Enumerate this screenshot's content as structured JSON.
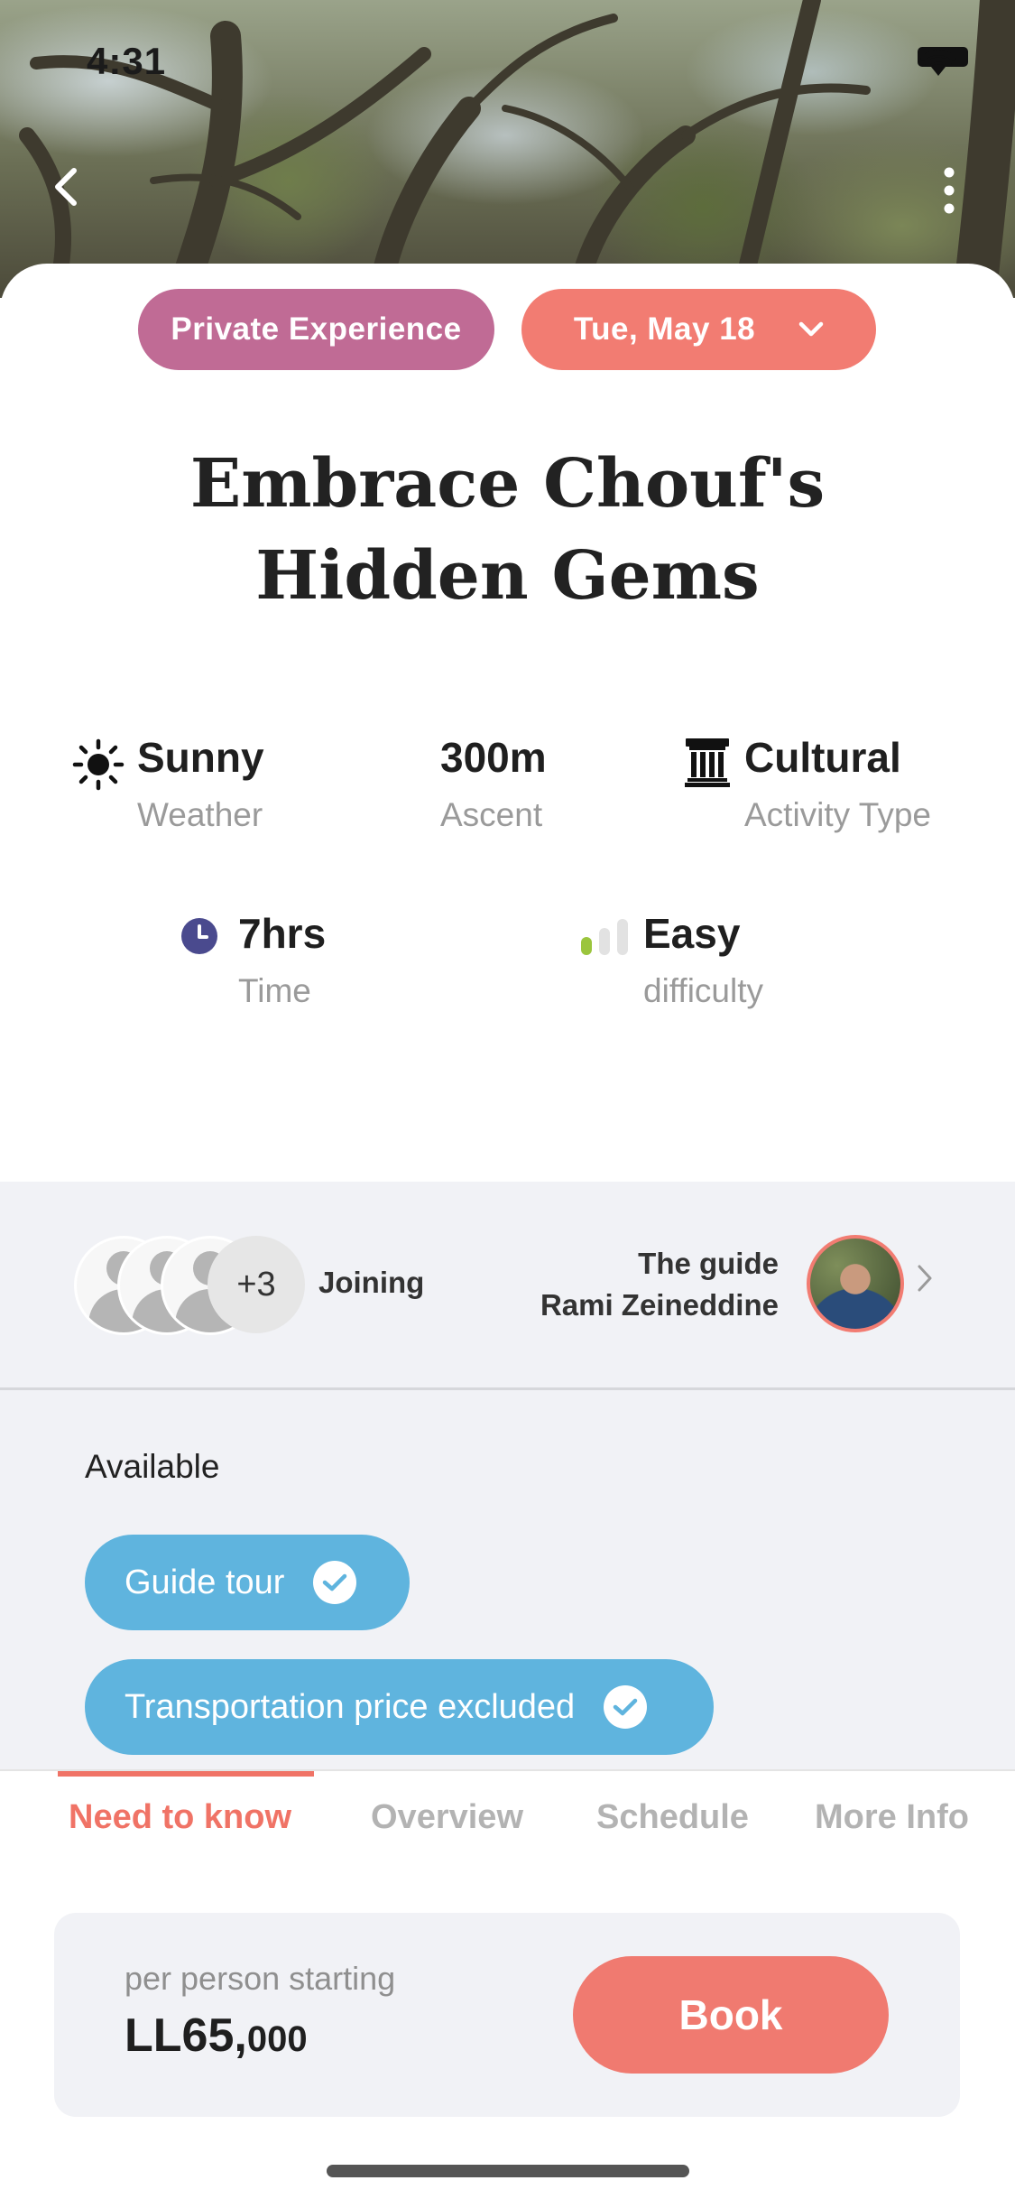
{
  "status_bar": {
    "time": "4:31"
  },
  "hero": {
    "back_icon": "chevron-left-icon",
    "more_icon": "more-vertical-icon"
  },
  "badges": {
    "experience": "Private Experience",
    "date": "Tue, May 18",
    "date_icon": "chevron-down-icon"
  },
  "title": {
    "line1": "Embrace Chouf's",
    "line2": "Hidden Gems"
  },
  "stats": {
    "weather": {
      "value": "Sunny",
      "label": "Weather",
      "icon": "sun-icon"
    },
    "ascent": {
      "value": "300m",
      "label": "Ascent"
    },
    "activity": {
      "value": "Cultural",
      "label": "Activity Type",
      "icon": "landmark-icon"
    },
    "time": {
      "value": "7hrs",
      "label": "Time",
      "icon": "clock-icon"
    },
    "difficulty": {
      "value": "Easy",
      "label": "difficulty",
      "icon": "signal-bars-icon",
      "level": 1,
      "max": 3
    }
  },
  "participants": {
    "extra": "+3",
    "label": "Joining"
  },
  "guide": {
    "caption": "The guide",
    "name": "Rami Zeineddine"
  },
  "available": {
    "heading": "Available",
    "tags": [
      "Guide tour",
      "Transportation price excluded"
    ]
  },
  "tabs": [
    "Need to know",
    "Overview",
    "Schedule",
    "More Info"
  ],
  "booking": {
    "caption": "per person starting",
    "price_main": "LL65,",
    "price_small": "000",
    "button": "Book"
  },
  "colors": {
    "accent": "#f07366",
    "private_badge": "#c06b95",
    "tag_blue": "#5fb4de",
    "difficulty_green": "#9bc53d"
  }
}
